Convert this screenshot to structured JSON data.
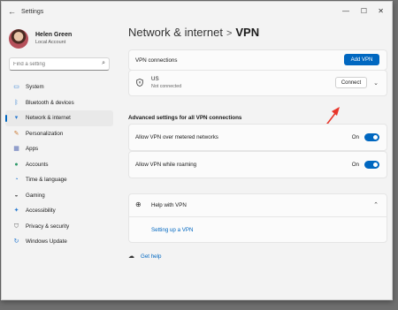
{
  "window": {
    "app_title": "Settings"
  },
  "user": {
    "name": "Helen Green",
    "account": "Local Account"
  },
  "search": {
    "placeholder": "Find a setting"
  },
  "sidebar": {
    "items": [
      {
        "label": "System",
        "icon": "monitor-icon"
      },
      {
        "label": "Bluetooth & devices",
        "icon": "bluetooth-icon"
      },
      {
        "label": "Network & internet",
        "icon": "wifi-icon",
        "active": true
      },
      {
        "label": "Personalization",
        "icon": "brush-icon"
      },
      {
        "label": "Apps",
        "icon": "apps-icon"
      },
      {
        "label": "Accounts",
        "icon": "person-icon"
      },
      {
        "label": "Time & language",
        "icon": "globe-clock-icon"
      },
      {
        "label": "Gaming",
        "icon": "gamepad-icon"
      },
      {
        "label": "Accessibility",
        "icon": "accessibility-icon"
      },
      {
        "label": "Privacy & security",
        "icon": "shield-icon"
      },
      {
        "label": "Windows Update",
        "icon": "update-icon"
      }
    ]
  },
  "breadcrumb": {
    "parent": "Network & internet",
    "separator": ">",
    "current": "VPN"
  },
  "vpn": {
    "connections_label": "VPN connections",
    "add_button": "Add VPN",
    "entry": {
      "name": "US",
      "status": "Not connected",
      "connect_button": "Connect"
    }
  },
  "advanced": {
    "heading": "Advanced settings for all VPN connections",
    "metered": {
      "label": "Allow VPN over metered networks",
      "state": "On"
    },
    "roaming": {
      "label": "Allow VPN while roaming",
      "state": "On"
    }
  },
  "help": {
    "title": "Help with VPN",
    "link": "Setting up a VPN"
  },
  "get_help": "Get help",
  "colors": {
    "accent": "#0067c0",
    "annotation_arrow": "#e8352a"
  }
}
